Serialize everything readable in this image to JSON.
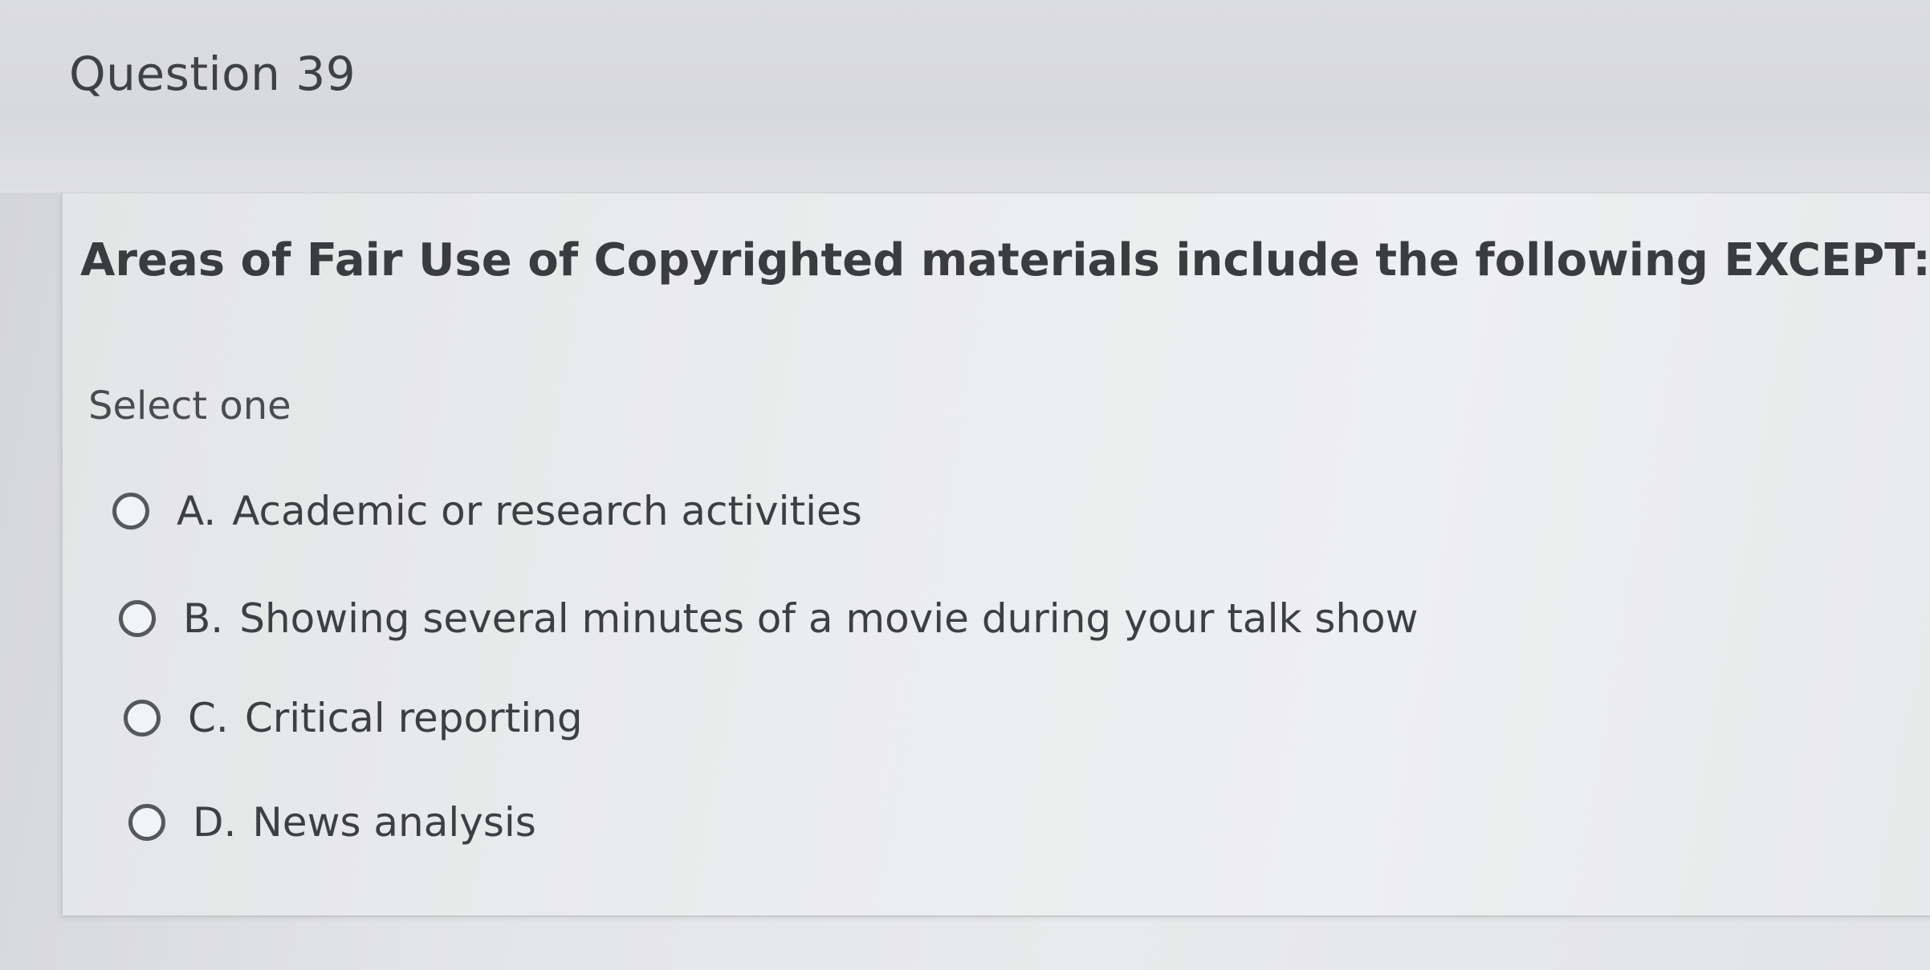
{
  "question": {
    "number_label": "Question 39",
    "text": "Areas of Fair Use of Copyrighted materials include the following EXCEPT:",
    "instruction": "Select one"
  },
  "options": [
    {
      "letter": "A.",
      "label": "Academic or research activities",
      "selected": false
    },
    {
      "letter": "B.",
      "label": "Showing several minutes of a movie during your talk show",
      "selected": false
    },
    {
      "letter": "C.",
      "label": "Critical reporting",
      "selected": false
    },
    {
      "letter": "D.",
      "label": "News analysis",
      "selected": false
    }
  ],
  "colors": {
    "text": "#3d4043",
    "radio_border": "#55585c",
    "card_background": "#ebeced"
  }
}
